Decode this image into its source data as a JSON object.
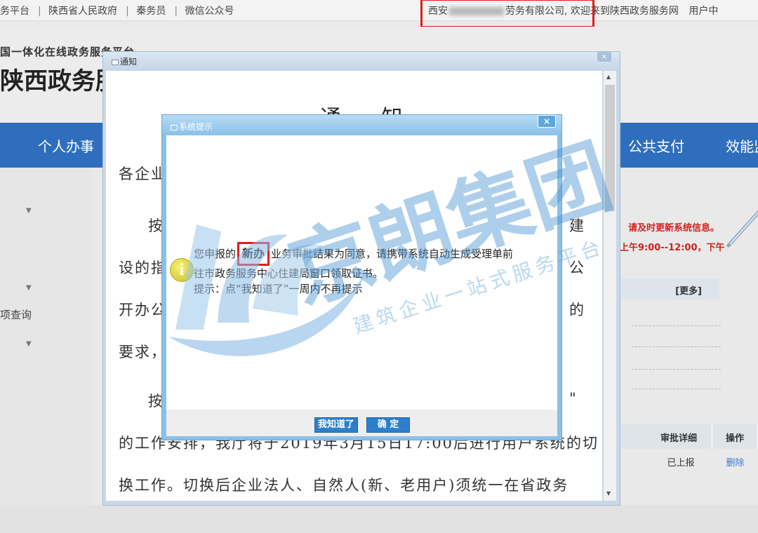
{
  "topbar": {
    "left_items": [
      "务平台",
      "陕西省人民政府",
      "秦务员",
      "微信公众号"
    ],
    "company_prefix": "西安",
    "company_suffix": "劳务有限公司,",
    "welcome": "欢迎来到陕西政务服务网",
    "user_center": "用户中"
  },
  "brand": {
    "subtitle": "国一体化在线政务服务平台",
    "title": "陕西政务服"
  },
  "navbar": {
    "items": [
      "个人办事",
      "公共支付",
      "效能监"
    ]
  },
  "sidebar": {
    "label": "项查询"
  },
  "rightpanel": {
    "notice_line1": "请及时更新系统信息。",
    "notice_line2": "上午9:00--12:00，下午",
    "more": "[更多]",
    "col_detail": "审批详细",
    "col_action": "操作",
    "status": "已上报",
    "delete": "删除"
  },
  "notice_window": {
    "title": "通知",
    "close": "×",
    "heading": "通   知",
    "lines": [
      "各企业",
      "按",
      "设的指",
      "开办公",
      "要求，",
      "按",
      "的工作安排，我厅将于2019年3月15日17:00后进行用户系统的切",
      "换工作。切换后企业法人、自然人(新、老用户)须统一在省政务"
    ],
    "right_fragments": [
      "建",
      "公",
      "的",
      "\""
    ]
  },
  "watermark": {
    "company": "京朗集团",
    "slogan": "建筑企业一站式服务平台"
  },
  "dialog": {
    "title": "系统提示",
    "close": "×",
    "msg_pre": "您申报的",
    "msg_highlight": "新办",
    "msg_post": "业务审批结果为同意，请携带系统自动生成受理单前",
    "msg_line2": "往市政务服务中心住建局窗口领取证书。",
    "msg_line3": "提示：点“我知道了”一周内不再提示",
    "btn_know": "我知道了",
    "btn_ok": "确 定"
  }
}
